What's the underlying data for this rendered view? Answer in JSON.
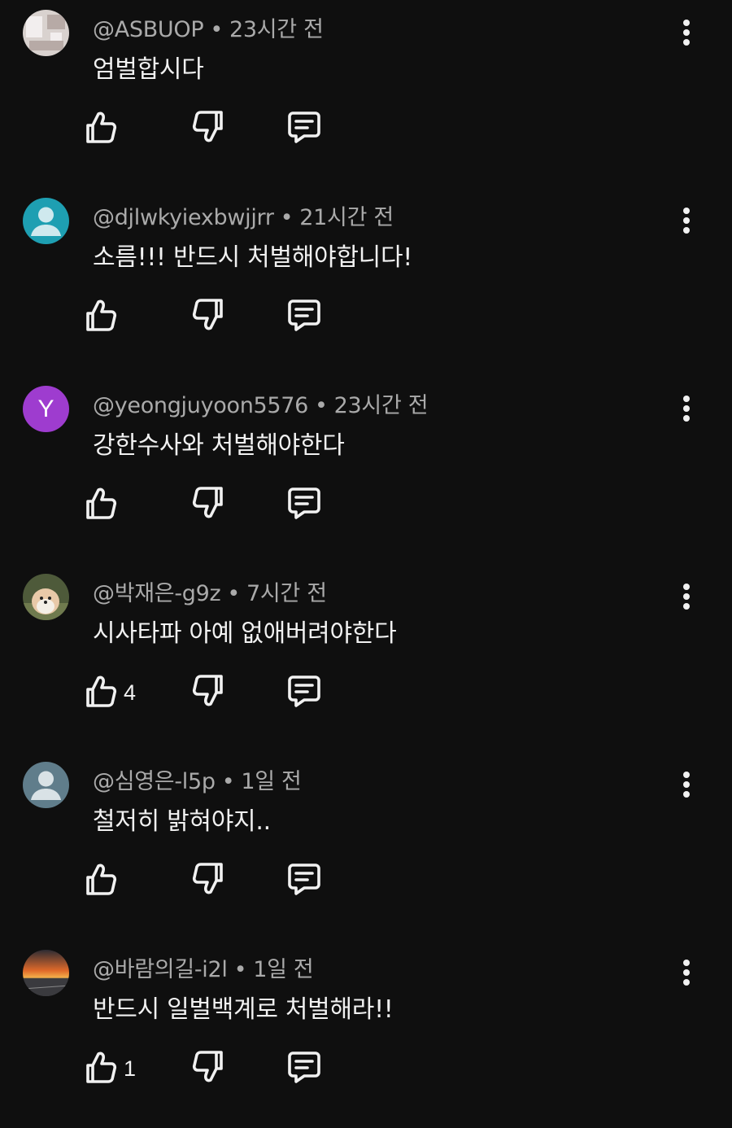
{
  "comments": [
    {
      "author": "@ASBUOP",
      "time": "23시간 전",
      "text": "엄벌합시다",
      "like_count": "",
      "avatar": {
        "kind": "image",
        "name": "room-photo-avatar",
        "colors": [
          "#d9d2cf",
          "#f2eeee",
          "#b7aaa6"
        ]
      }
    },
    {
      "author": "@djlwkyiexbwjjrr",
      "time": "21시간 전",
      "text": "소름!!! 반드시 처벌해야합니다!",
      "like_count": "",
      "avatar": {
        "kind": "default",
        "name": "default-user-avatar",
        "colors": [
          "#1e9fb2",
          "#cfe9ee"
        ]
      }
    },
    {
      "author": "@yeongjuyoon5576",
      "time": "23시간 전",
      "text": "강한수사와 처벌해야한다",
      "like_count": "",
      "avatar": {
        "kind": "letter",
        "name": "letter-avatar",
        "letter": "Y",
        "colors": [
          "#9e3ccf"
        ]
      }
    },
    {
      "author": "@박재은-g9z",
      "time": "7시간 전",
      "text": "시사타파 아예 없애버려야한다",
      "like_count": "4",
      "avatar": {
        "kind": "image",
        "name": "dog-photo-avatar",
        "colors": [
          "#4e5a3a",
          "#e8c9a8",
          "#f4efe6"
        ]
      }
    },
    {
      "author": "@심영은-l5p",
      "time": "1일 전",
      "text": "철저히 밝혀야지..",
      "like_count": "",
      "avatar": {
        "kind": "default",
        "name": "default-user-avatar",
        "colors": [
          "#607d8b",
          "#d9e2e6"
        ]
      }
    },
    {
      "author": "@바람의길-i2l",
      "time": "1일 전",
      "text": "반드시 일벌백계로 처벌해라!!",
      "like_count": "1",
      "avatar": {
        "kind": "image",
        "name": "sunset-photo-avatar",
        "colors": [
          "#e06a2a",
          "#3a3a3e",
          "#f4b04a"
        ]
      }
    }
  ],
  "icons": {
    "like": "thumbs-up-icon",
    "dislike": "thumbs-down-icon",
    "reply": "reply-comment-icon",
    "menu": "more-vert-icon"
  },
  "colors": {
    "background": "#0f0f0f",
    "primary_text": "#f1f1f1",
    "secondary_text": "#aaaaaa"
  }
}
